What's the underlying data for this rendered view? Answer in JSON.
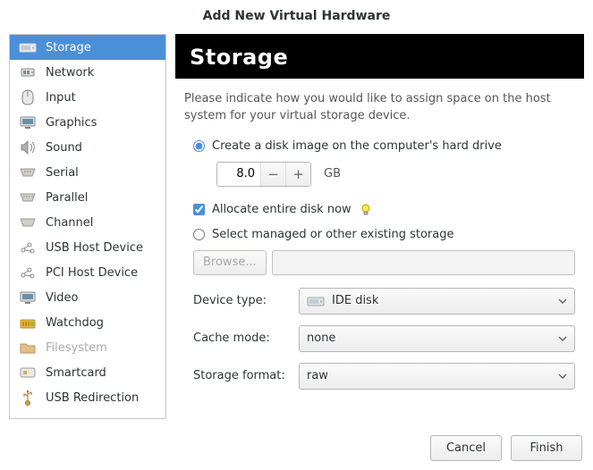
{
  "window": {
    "title": "Add New Virtual Hardware"
  },
  "sidebar": {
    "items": [
      {
        "label": "Storage"
      },
      {
        "label": "Network"
      },
      {
        "label": "Input"
      },
      {
        "label": "Graphics"
      },
      {
        "label": "Sound"
      },
      {
        "label": "Serial"
      },
      {
        "label": "Parallel"
      },
      {
        "label": "Channel"
      },
      {
        "label": "USB Host Device"
      },
      {
        "label": "PCI Host Device"
      },
      {
        "label": "Video"
      },
      {
        "label": "Watchdog"
      },
      {
        "label": "Filesystem"
      },
      {
        "label": "Smartcard"
      },
      {
        "label": "USB Redirection"
      }
    ]
  },
  "panel": {
    "heading": "Storage",
    "description": "Please indicate how you would like to assign space on the host system for your virtual storage device.",
    "radio_create": "Create a disk image on the computer's hard drive",
    "size_value": "8.0",
    "size_unit": "GB",
    "allocate_label": "Allocate entire disk now",
    "radio_select": "Select managed or other existing storage",
    "browse_label": "Browse...",
    "device_type_label": "Device type:",
    "device_type_value": "IDE disk",
    "cache_mode_label": "Cache mode:",
    "cache_mode_value": "none",
    "storage_format_label": "Storage format:",
    "storage_format_value": "raw"
  },
  "footer": {
    "cancel": "Cancel",
    "finish": "Finish"
  }
}
